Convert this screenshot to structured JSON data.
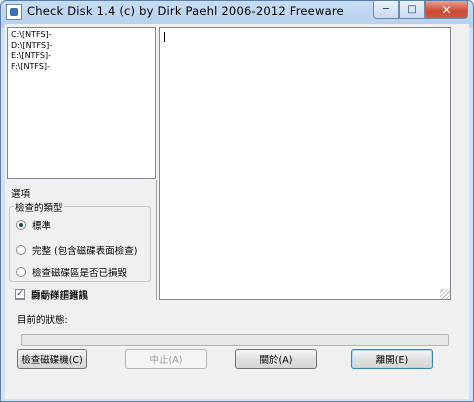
{
  "window": {
    "title": "Check Disk 1.4  (c) by Dirk Paehl  2006-2012 Freeware"
  },
  "drives": [
    "C:\\[NTFS]-",
    "D:\\[NTFS]-",
    "E:\\[NTFS]-",
    "F:\\[NTFS]-"
  ],
  "options": {
    "title": "選項",
    "group_label": "檢查的類型",
    "radios": [
      {
        "label": "標準",
        "checked": true
      },
      {
        "label": "完整 (包含磁碟表面檢查)",
        "checked": false
      },
      {
        "label": "檢查磁碟區是否已損毀",
        "checked": false
      }
    ],
    "checks": [
      {
        "label": "自動修正錯誤",
        "checked": false
      },
      {
        "label": "顯示詳細資訊",
        "checked": true
      }
    ]
  },
  "status": {
    "label": "目前的狀態:",
    "progress": 0
  },
  "buttons": {
    "check": "檢查磁碟機(C)",
    "stop": "中止(A)",
    "about": "關於(A)",
    "exit": "離開(E)"
  }
}
